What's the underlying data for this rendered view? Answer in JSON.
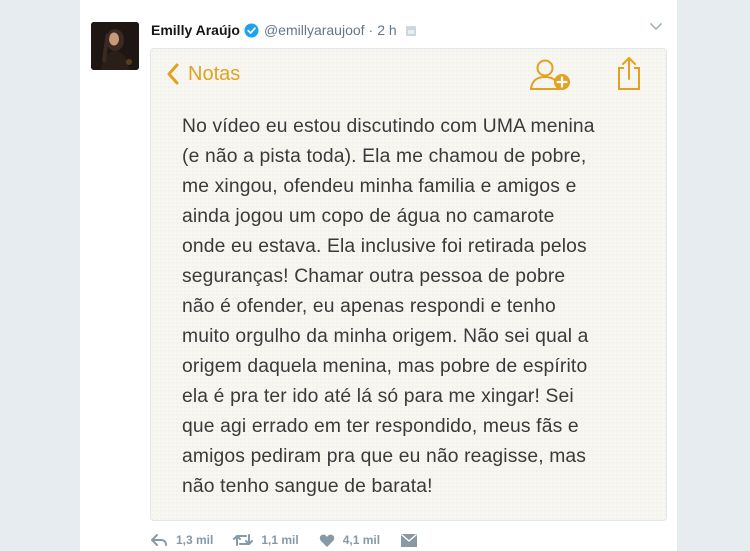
{
  "tweet": {
    "display_name": "Emilly Araújo",
    "handle": "@emillyaraujoof",
    "separator": "·",
    "time": "2 h",
    "verified": true
  },
  "note": {
    "back_label": "Notas",
    "accent_color": "#e3a121",
    "lines": [
      "No vídeo eu estou discutindo com UMA menina",
      "(e não a pista toda). Ela me chamou de pobre,",
      "me xingou, ofendeu minha familia e amigos e",
      "ainda jogou um copo de água no camarote",
      "onde eu estava. Ela inclusive foi retirada pelos",
      "seguranças! Chamar outra pessoa de pobre",
      "não é ofender, eu apenas respondi e tenho",
      "muito orgulho da minha origem. Não sei qual a",
      "origem daquela menina, mas pobre de espírito",
      "ela é pra ter ido até lá só para me xingar! Sei",
      "que agi errado em ter respondido, meus fãs e",
      "amigos pediram pra que eu não reagisse, mas",
      "não tenho sangue de barata!"
    ]
  },
  "actions": {
    "reply_count": "1,3 mil",
    "retweet_count": "1,1 mil",
    "like_count": "4,1 mil"
  },
  "icons": [
    "verified-badge-icon",
    "lock-icon",
    "chevron-down-icon",
    "back-chevron-icon",
    "add-person-icon",
    "share-icon",
    "reply-icon",
    "retweet-icon",
    "heart-icon",
    "direct-message-icon"
  ]
}
